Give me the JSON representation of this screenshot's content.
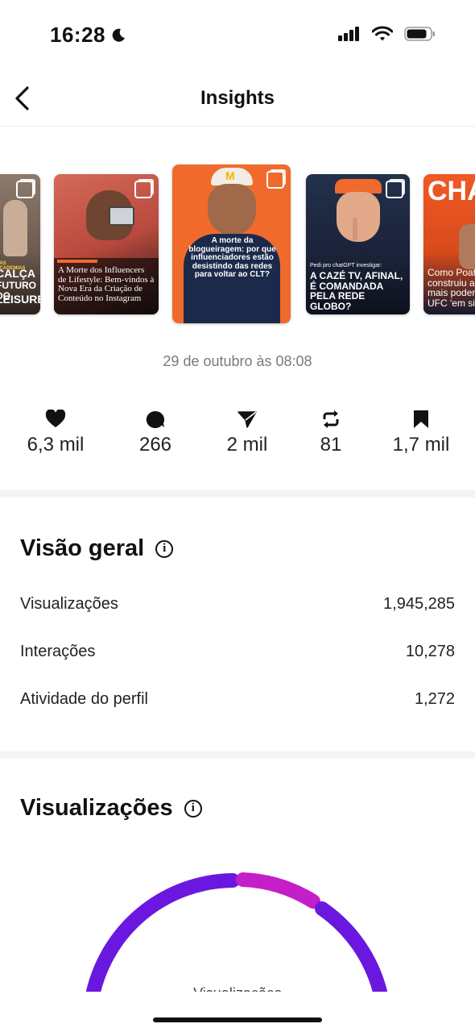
{
  "status": {
    "time": "16:28"
  },
  "header": {
    "title": "Insights"
  },
  "posts": [
    {
      "caption_a": "CALÇA",
      "caption_b": "FUTURO DO",
      "caption_c": "LEISURE",
      "kicker": "DAS ACADEMIAS"
    },
    {
      "caption": "A Morte dos Influencers de Lifestyle: Bem-vindos à Nova Era da Criação de Conteúdo no Instagram"
    },
    {
      "caption": "A morte da blogueiragem: por que influenciadores estão desistindo das redes para voltar ao CLT?"
    },
    {
      "kicker": "Pedi pro chatGPT investigar:",
      "caption": "A CAZÉ TV, AFINAL, É COMANDADA PELA REDE GLOBO?"
    },
    {
      "headline": "CHA",
      "caption": "Como Poata construiu a mais podero UFC 'em silê"
    }
  ],
  "post_date": "29 de outubro às 08:08",
  "stats": {
    "likes": "6,3 mil",
    "comments": "266",
    "shares": "2 mil",
    "reposts": "81",
    "saves": "1,7 mil"
  },
  "overview": {
    "title": "Visão geral",
    "rows": [
      {
        "label": "Visualizações",
        "value": "1,945,285"
      },
      {
        "label": "Interações",
        "value": "10,278"
      },
      {
        "label": "Atividade do perfil",
        "value": "1,272"
      }
    ]
  },
  "views_section": {
    "title": "Visualizações",
    "center_label": "Visualizações"
  },
  "colors": {
    "gauge_primary": "#6a18e0",
    "gauge_secondary": "#c41ec9",
    "accent_orange": "#f06a2c"
  }
}
